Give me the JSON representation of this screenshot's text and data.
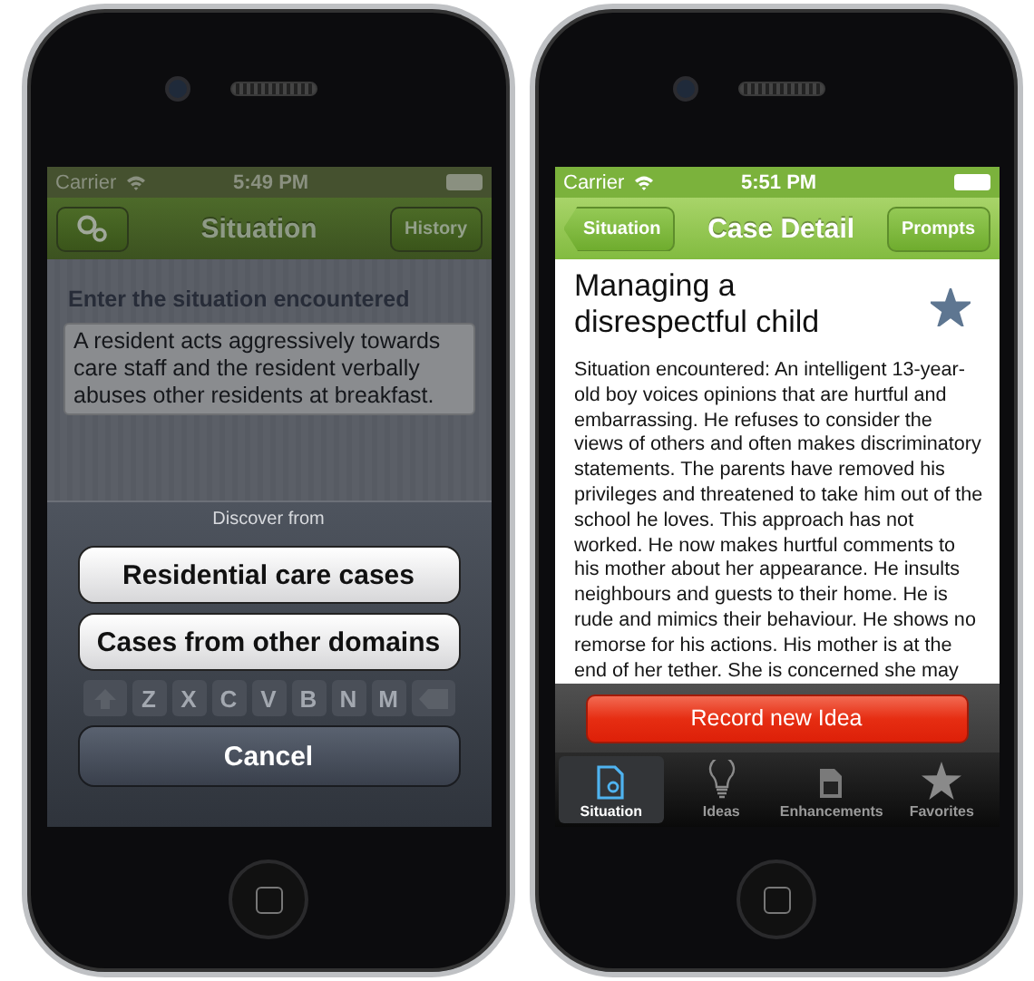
{
  "situation_screen": {
    "status_bar": {
      "carrier": "Carrier",
      "time": "5:49 PM"
    },
    "nav_bar": {
      "title": "Situation",
      "right_button": "History"
    },
    "prompt": "Enter the situation encountered",
    "situation_text": "A resident acts aggressively towards care staff and the resident verbally abuses other residents at breakfast.",
    "action_sheet": {
      "title": "Discover from",
      "buttons": [
        {
          "label": "Residential care cases",
          "kind": "option"
        },
        {
          "label": "Cases from other domains",
          "kind": "option"
        },
        {
          "label": "Cancel",
          "kind": "cancel"
        }
      ]
    },
    "keyboard_row": [
      "Z",
      "X",
      "C",
      "V",
      "B",
      "N",
      "M"
    ]
  },
  "case_detail_screen": {
    "status_bar": {
      "carrier": "Carrier",
      "time": "5:51 PM"
    },
    "nav_bar": {
      "back_button": "Situation",
      "title": "Case Detail",
      "right_button": "Prompts"
    },
    "case_title": "Managing a disrespectful child",
    "favorite": true,
    "body": "Situation encountered:  An intelligent 13-year-old boy voices opinions that are hurtful and embarrassing. He refuses to consider the views of others and often makes discriminatory statements. The parents have removed his privileges and threatened to take him out of the school he loves. This approach has not worked. He now makes hurtful comments to his mother about her appearance. He insults neighbours and guests to their home. He is rude and mimics their behaviour. He shows no remorse for his actions. His mother is at the end of her tether. She is concerned she may",
    "record_button": "Record new Idea",
    "tabs": [
      {
        "label": "Situation",
        "selected": true
      },
      {
        "label": "Ideas",
        "selected": false
      },
      {
        "label": "Enhancements",
        "selected": false
      },
      {
        "label": "Favorites",
        "selected": false
      }
    ]
  }
}
